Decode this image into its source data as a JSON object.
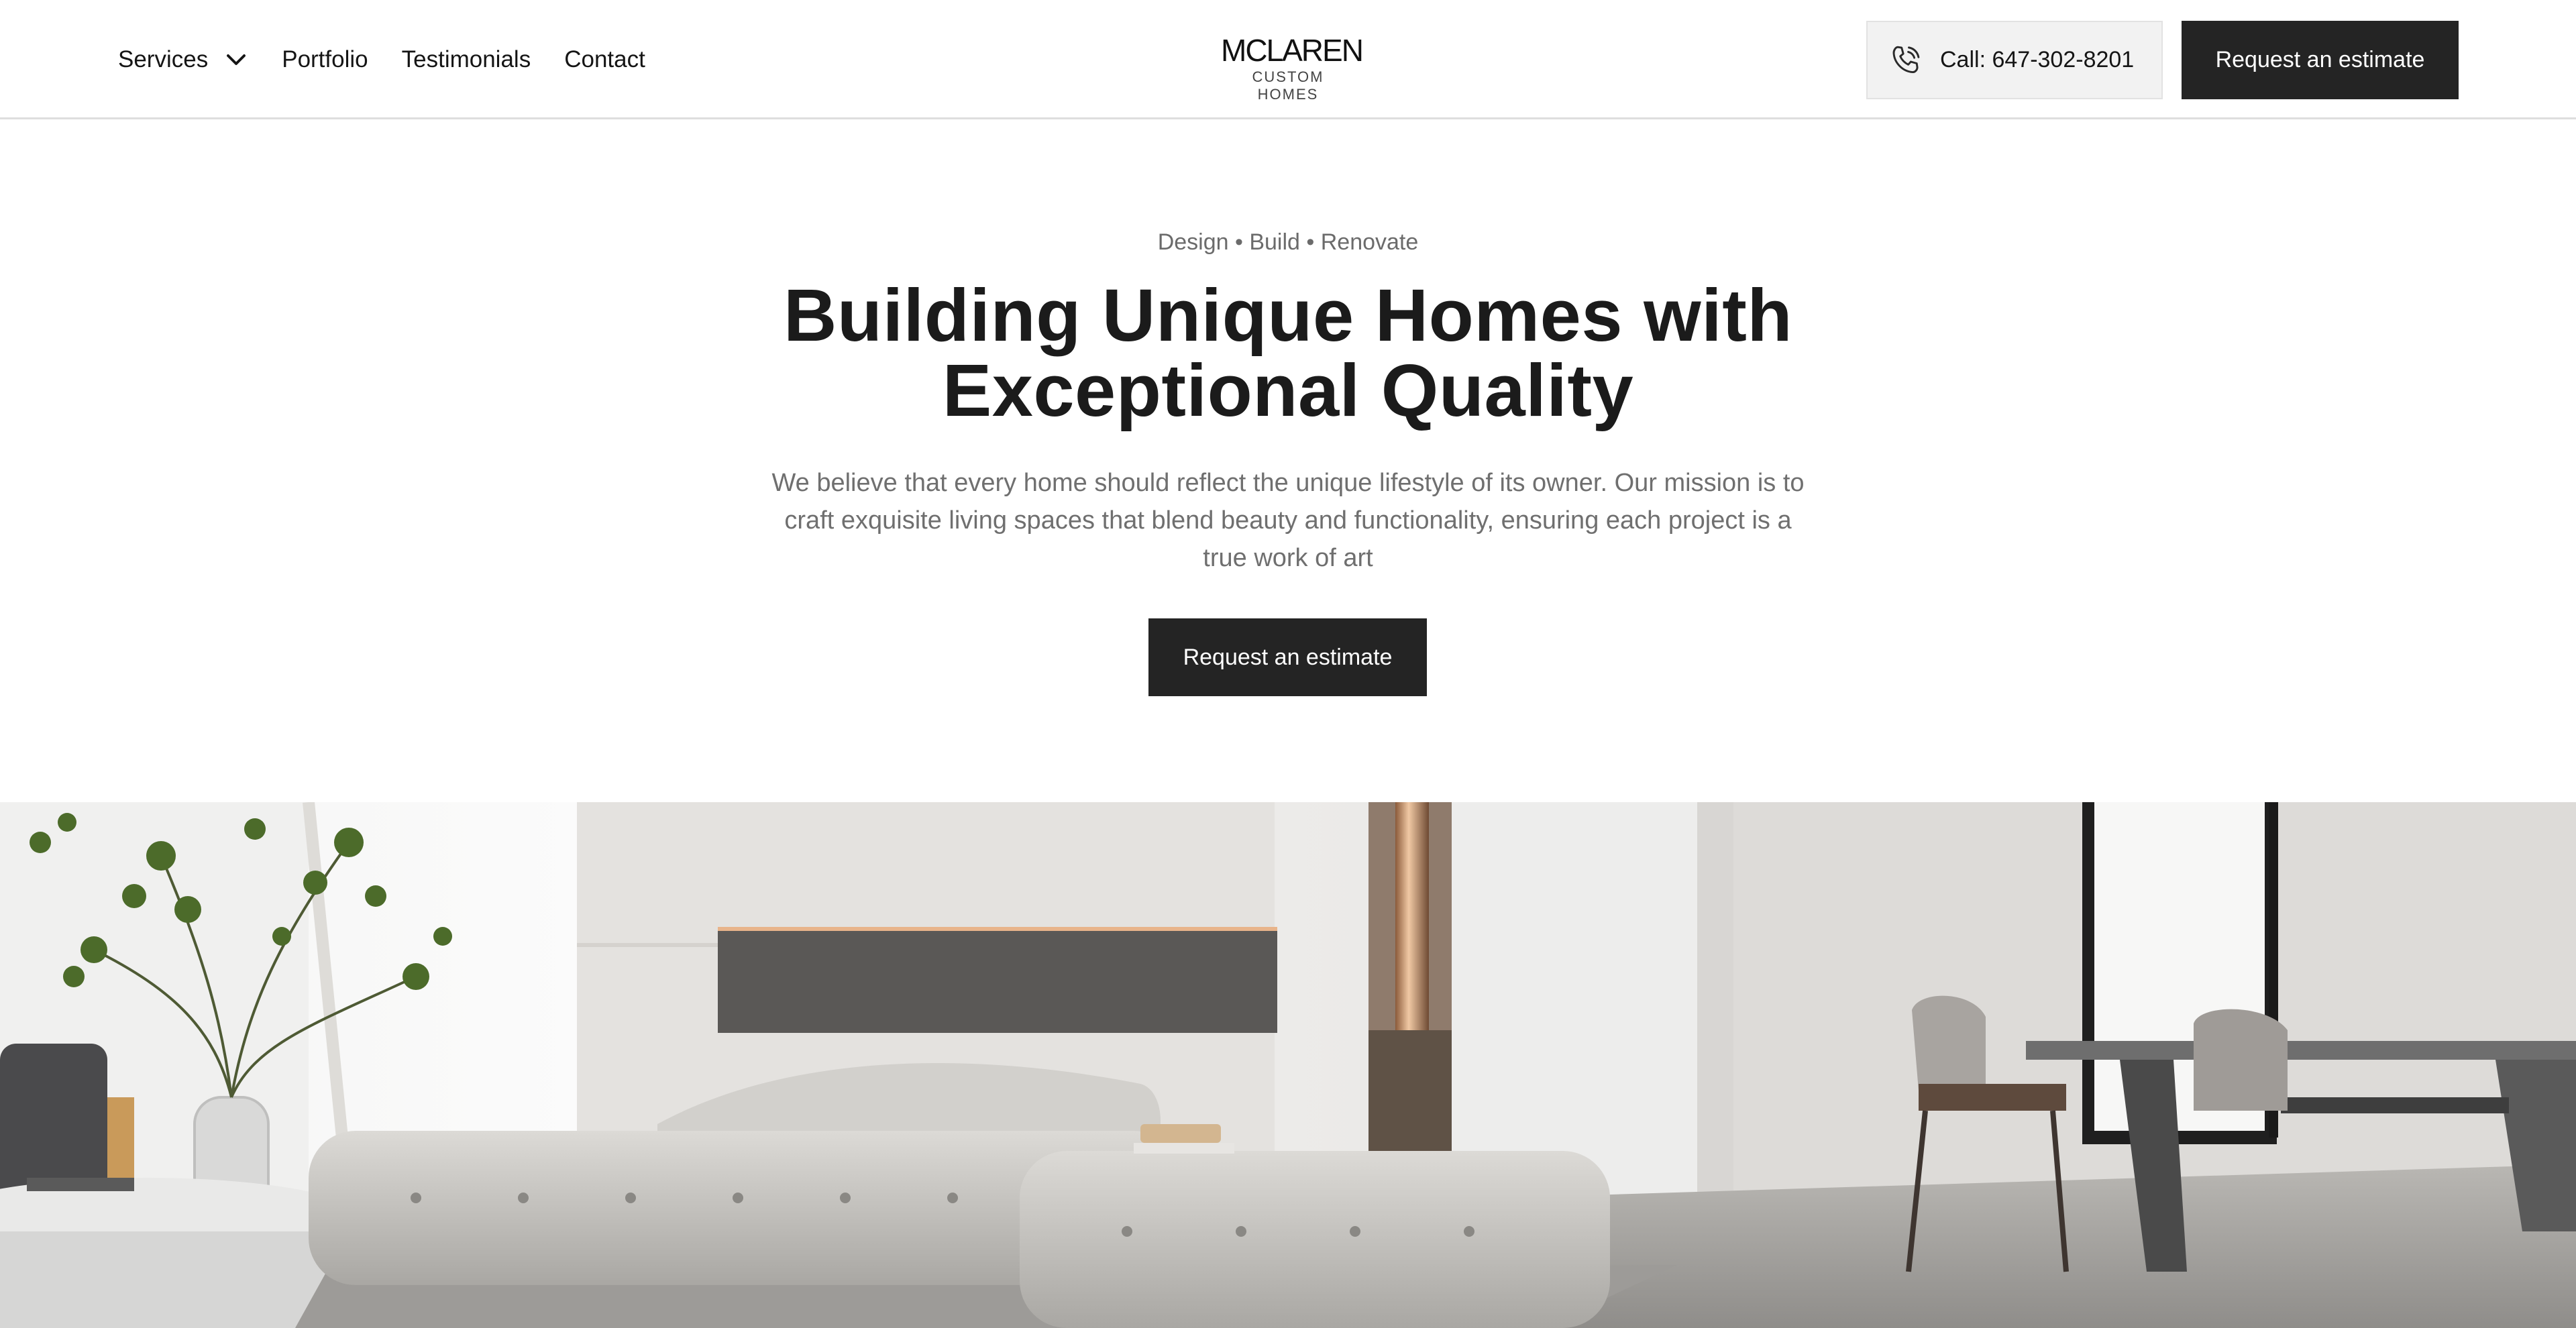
{
  "header": {
    "nav": [
      {
        "label": "Services",
        "has_dropdown": true
      },
      {
        "label": "Portfolio"
      },
      {
        "label": "Testimonials"
      },
      {
        "label": "Contact"
      }
    ],
    "logo": {
      "main": "MCLAREN",
      "sub": "CUSTOM HOMES"
    },
    "call_label": "Call: 647-302-8201",
    "cta_label": "Request an estimate"
  },
  "hero": {
    "eyebrow": "Design • Build • Renovate",
    "headline_line1": "Building Unique Homes with",
    "headline_line2": "Exceptional Quality",
    "lead": "We believe that every home should reflect the unique lifestyle of its owner. Our mission is to craft exquisite living spaces that blend beauty and functionality, ensuring each project is a true work of art",
    "cta_label": "Request an estimate"
  },
  "icons": {
    "services_chevron": "chevron-down-icon",
    "phone": "phone-icon"
  },
  "colors": {
    "button_dark": "#242424",
    "call_bg": "#f2f2f2",
    "text_dark": "#1b1b1b",
    "text_muted": "#6f6f6f"
  }
}
